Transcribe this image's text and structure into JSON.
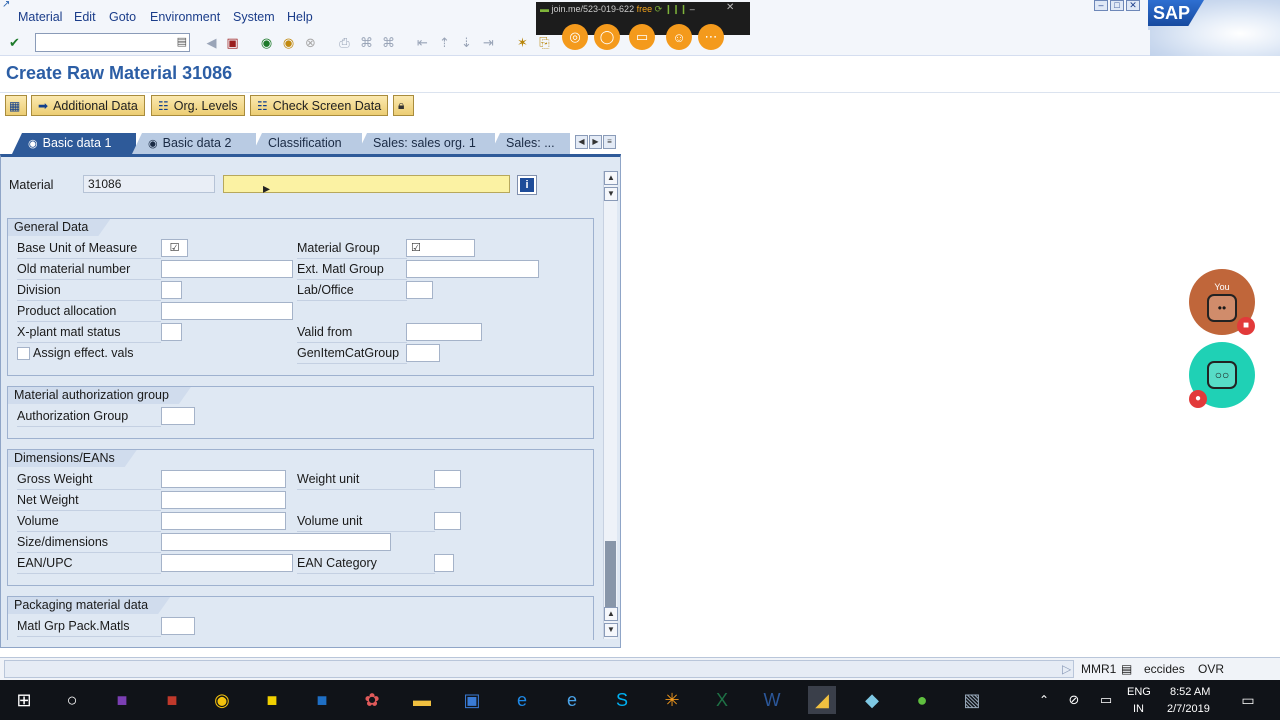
{
  "menubar": {
    "items": [
      "Material",
      "Edit",
      "Goto",
      "Environment",
      "System",
      "Help"
    ],
    "brand": "SAP"
  },
  "joinme": {
    "url": "join.me/523-019-622",
    "plan": "free"
  },
  "toolbar": {
    "command_value": ""
  },
  "page": {
    "title": "Create Raw Material 31086"
  },
  "app_toolbar": {
    "buttons": [
      "Additional Data",
      "Org. Levels",
      "Check Screen Data"
    ]
  },
  "tabs": [
    "Basic data 1",
    "Basic data 2",
    "Classification",
    "Sales: sales org. 1",
    "Sales: ..."
  ],
  "material": {
    "label": "Material",
    "number": "31086",
    "description": ""
  },
  "general_data": {
    "title": "General Data",
    "base_uom_label": "Base Unit of Measure",
    "material_group_label": "Material Group",
    "old_material_label": "Old material number",
    "ext_matl_group_label": "Ext. Matl Group",
    "division_label": "Division",
    "lab_office_label": "Lab/Office",
    "product_allocation_label": "Product allocation",
    "xplant_status_label": "X-plant matl status",
    "valid_from_label": "Valid from",
    "assign_effect_label": "Assign effect. vals",
    "gen_item_cat_label": "GenItemCatGroup"
  },
  "auth_group": {
    "title": "Material authorization group",
    "label": "Authorization Group"
  },
  "dimensions": {
    "title": "Dimensions/EANs",
    "gross_weight_label": "Gross Weight",
    "weight_unit_label": "Weight unit",
    "net_weight_label": "Net Weight",
    "volume_label": "Volume",
    "volume_unit_label": "Volume unit",
    "size_label": "Size/dimensions",
    "ean_label": "EAN/UPC",
    "ean_category_label": "EAN Category"
  },
  "packaging": {
    "title": "Packaging material data",
    "label": "Matl Grp Pack.Matls"
  },
  "statusbar": {
    "transaction": "MMR1",
    "user": "eccides",
    "mode": "OVR"
  },
  "participants": {
    "you_label": "You"
  },
  "taskbar": {
    "language": "ENG",
    "region": "IN",
    "time": "8:52 AM",
    "date": "2/7/2019"
  },
  "colors": {
    "accent": "#2e5a99",
    "title": "#2c5ea5",
    "joinme_orange": "#f49a1c",
    "avatar_you": "#c0663a",
    "avatar_other": "#1fd1b5"
  }
}
